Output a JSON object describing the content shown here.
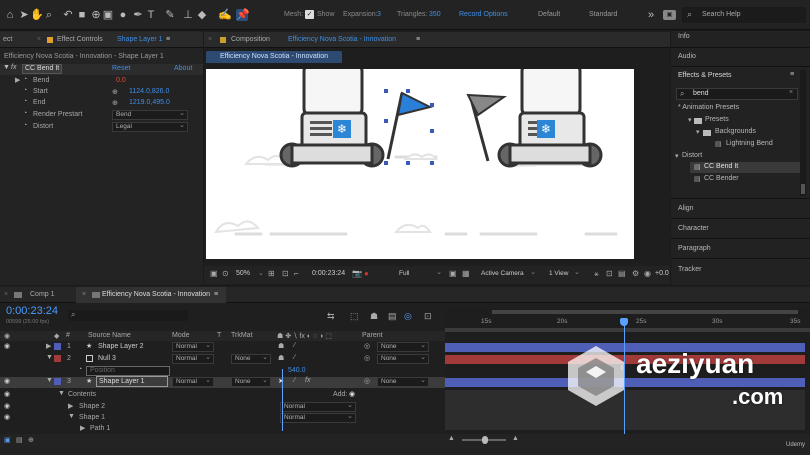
{
  "toolbar": {
    "tools": [
      "home-icon",
      "hand-icon",
      "zoom-icon",
      "undo-icon",
      "camera-icon",
      "pan-behind-icon",
      "rectangle-icon",
      "ellipse-icon",
      "pen-icon",
      "type-icon",
      "brush-icon",
      "clone-stamp-icon",
      "eraser-icon",
      "roto-brush-icon",
      "puppet-pin-icon"
    ],
    "mesh_label": "Mesh:",
    "show_label": "Show",
    "expansion_label": "Expansion:",
    "expansion_value": "3",
    "triangles_label": "Triangles:",
    "triangles_value": "350",
    "record_options": "Record Options",
    "workspace_default": "Default",
    "workspace_standard": "Standard",
    "search_help": "Search Help"
  },
  "effect_controls": {
    "left_tab": "ect",
    "tab_label": "Effect Controls",
    "tab_target": "Shape Layer 1",
    "breadcrumb": "Efficiency Nova Scotia - Innovation - Shape Layer 1",
    "effect_name": "CC Bend It",
    "reset": "Reset",
    "about": "About",
    "properties": [
      {
        "name": "Bend",
        "value": "0.0"
      },
      {
        "name": "Start",
        "value": "1124.0,826.0"
      },
      {
        "name": "End",
        "value": "1219.0,495.0"
      },
      {
        "name": "Render Prestart",
        "value": "Bend"
      },
      {
        "name": "Distort",
        "value": "Legal"
      }
    ]
  },
  "composition": {
    "tab_label": "Composition",
    "tab_name": "Efficiency Nova Scotia - Innovation",
    "sub_tab": "Efficiency Nova Scotia - Innovation",
    "zoom": "50%",
    "timecode": "0:00:23:24",
    "resolution": "Full",
    "camera": "Active Camera",
    "views": "1 View",
    "exposure": "+0.0"
  },
  "right_panel": {
    "info": "Info",
    "audio": "Audio",
    "effects_presets": "Effects & Presets",
    "search_value": "bend",
    "tree": [
      "* Animation Presets",
      "Presets",
      "Backgrounds",
      "Lightning Bend",
      "Distort",
      "CC Bend It",
      "CC Bender"
    ],
    "align": "Align",
    "character": "Character",
    "paragraph": "Paragraph",
    "tracker": "Tracker"
  },
  "timeline": {
    "tabs": [
      "Comp 1",
      "Efficiency Nova Scotia - Innovation"
    ],
    "timecode": "0:00:23:24",
    "frames": "00599 (25.00 fps)",
    "columns": {
      "num": "#",
      "source": "Source Name",
      "mode": "Mode",
      "t": "T",
      "trkmat": "TrkMat",
      "parent": "Parent"
    },
    "layers": [
      {
        "num": "1",
        "name": "Shape Layer 2",
        "mode": "Normal",
        "trkmat": "",
        "parent": "None"
      },
      {
        "num": "2",
        "name": "Null 3",
        "mode": "Normal",
        "trkmat": "None",
        "parent": "None"
      },
      {
        "num": "",
        "name": "Position",
        "mode": "",
        "trkmat": "",
        "parent": "",
        "value": "540.0"
      },
      {
        "num": "3",
        "name": "Shape Layer 1",
        "mode": "Normal",
        "trkmat": "None",
        "parent": "None"
      }
    ],
    "contents": "Contents",
    "add": "Add:",
    "sub_items": [
      {
        "name": "Shape 2",
        "mode": "Normal"
      },
      {
        "name": "Shape 1",
        "mode": "Normal"
      },
      {
        "name": "Path 1",
        "mode": ""
      }
    ],
    "ruler": [
      "15s",
      "20s",
      "25s",
      "30s",
      "35s"
    ]
  },
  "watermark": {
    "line1": "aeziyuan",
    "line2": ".com",
    "corner": "Udemy"
  },
  "colors": {
    "accent": "#3f8fe6",
    "layer_blue": "#4f5fb8",
    "layer_red": "#a23a3a",
    "playhead": "#5aa0ff",
    "flag": "#2a7fd8"
  }
}
